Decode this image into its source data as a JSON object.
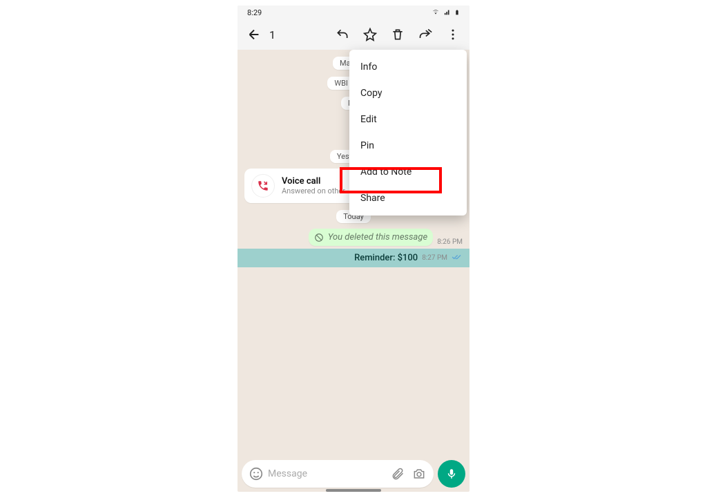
{
  "statusbar": {
    "time": "8:29"
  },
  "toolbar": {
    "count": "1"
  },
  "chat": {
    "chips": {
      "march": "March 3",
      "pinned": "WBI pinned",
      "mo": "Mo",
      "yesterday": "Yesterday",
      "today": "Today"
    },
    "call": {
      "title": "Voice call",
      "subtitle": "Answered on other"
    },
    "deleted": {
      "text": "You deleted this message",
      "time": "8:26 PM"
    },
    "selected": {
      "text": "Reminder: $100",
      "time": "8:27 PM"
    }
  },
  "menu": {
    "items": [
      "Info",
      "Copy",
      "Edit",
      "Pin",
      "Add to Note",
      "Share"
    ]
  },
  "input": {
    "placeholder": "Message"
  }
}
